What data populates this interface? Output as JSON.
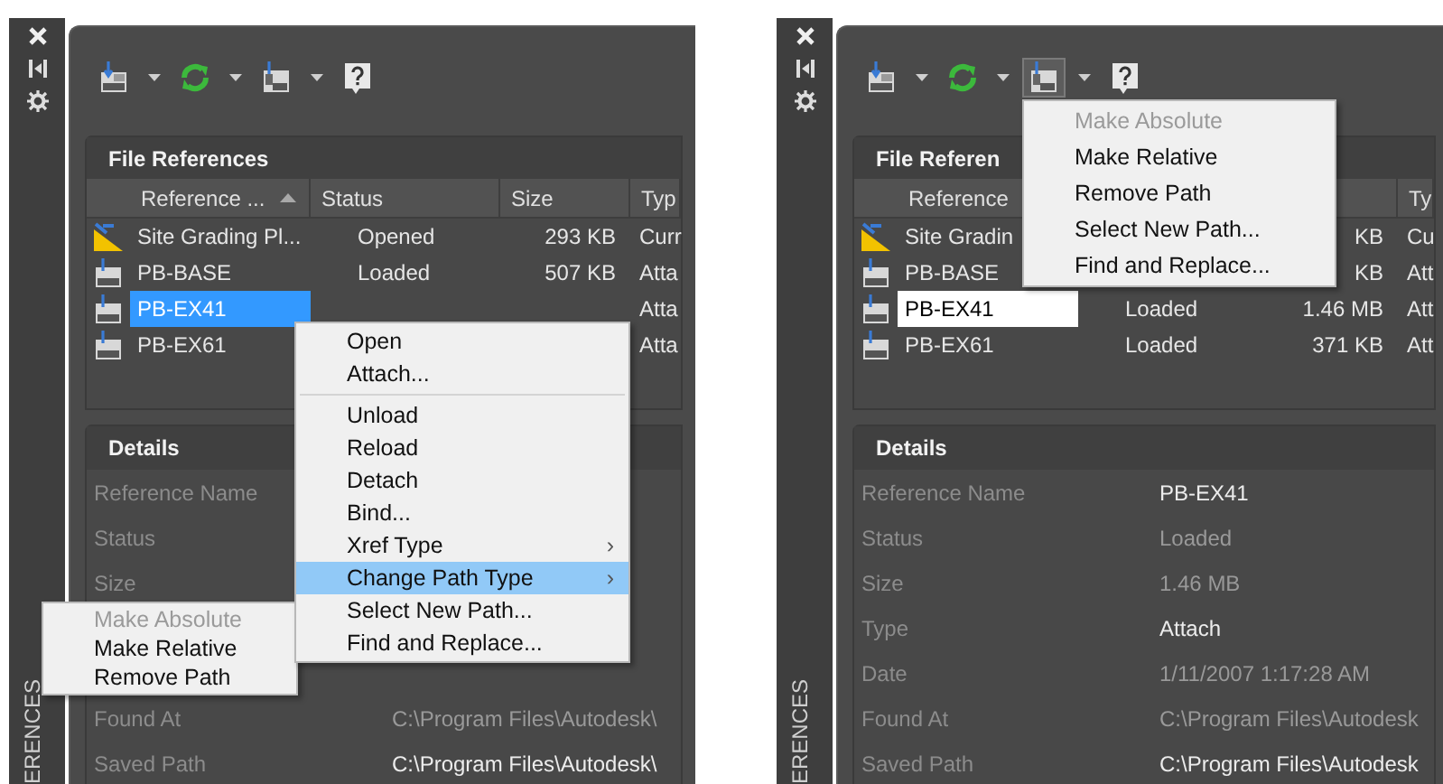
{
  "panels": [
    {
      "strip": {
        "title": "ERENCES"
      },
      "toolbar": [
        {
          "kind": "attach",
          "caret": true,
          "pressed": false
        },
        {
          "kind": "refresh",
          "caret": true,
          "pressed": false
        },
        {
          "kind": "path",
          "caret": true,
          "pressed": false
        },
        {
          "kind": "help",
          "caret": false,
          "pressed": false
        }
      ],
      "file_references": {
        "title": "File References",
        "list_focused": true,
        "columns": [
          {
            "label": "Reference ...",
            "sorted": true
          },
          {
            "label": "Status",
            "sorted": false
          },
          {
            "label": "Size",
            "sorted": false
          },
          {
            "label": "Typ",
            "sorted": false
          }
        ],
        "rows": [
          {
            "kind": "current",
            "name": "Site Grading Pl...",
            "status": "Opened",
            "size": "293 KB",
            "type": "Curr",
            "selected": false
          },
          {
            "kind": "dwg",
            "name": "PB-BASE",
            "status": "Loaded",
            "size": "507 KB",
            "type": "Atta",
            "selected": false
          },
          {
            "kind": "dwg",
            "name": "PB-EX41",
            "type": "Atta",
            "selected": true
          },
          {
            "kind": "dwg",
            "name": "PB-EX61",
            "type": "Atta",
            "selected": false
          }
        ]
      },
      "details": {
        "title": "Details",
        "fields": [
          {
            "label": "Reference Name"
          },
          {
            "label": "Status"
          },
          {
            "label": "Size"
          },
          {
            "kind": "covered"
          },
          {
            "kind": "covered"
          },
          {
            "label": "Found At",
            "value": "C:\\Program Files\\Autodesk\\",
            "editable": false
          },
          {
            "label": "Saved Path",
            "value": "C:\\Program Files\\Autodesk\\",
            "editable": true
          }
        ]
      },
      "menus": [
        {
          "kind": "submenu",
          "items": [
            {
              "kind": "item",
              "label": "Make Absolute",
              "disabled": true,
              "selected": false
            },
            {
              "kind": "item",
              "label": "Make Relative",
              "disabled": false,
              "selected": false
            },
            {
              "kind": "item",
              "label": "Remove Path",
              "disabled": false,
              "selected": false
            }
          ]
        },
        {
          "kind": "context",
          "items": [
            {
              "kind": "item",
              "label": "Open",
              "disabled": false,
              "selected": false
            },
            {
              "kind": "item",
              "label": "Attach...",
              "disabled": false,
              "selected": false
            },
            {
              "kind": "separator"
            },
            {
              "kind": "item",
              "label": "Unload",
              "disabled": false,
              "selected": false
            },
            {
              "kind": "item",
              "label": "Reload",
              "disabled": false,
              "selected": false
            },
            {
              "kind": "item",
              "label": "Detach",
              "disabled": false,
              "selected": false
            },
            {
              "kind": "item",
              "label": "Bind...",
              "disabled": false,
              "selected": false
            },
            {
              "kind": "item",
              "label": "Xref Type",
              "arrow": "›",
              "disabled": false,
              "selected": false
            },
            {
              "kind": "item",
              "label": "Change Path Type",
              "arrow": "›",
              "disabled": false,
              "selected": true
            },
            {
              "kind": "item",
              "label": "Select New Path...",
              "disabled": false,
              "selected": false
            },
            {
              "kind": "item",
              "label": "Find and Replace...",
              "disabled": false,
              "selected": false
            }
          ]
        }
      ]
    },
    {
      "strip": {
        "title": "ERENCES"
      },
      "toolbar": [
        {
          "kind": "attach",
          "caret": true,
          "pressed": false
        },
        {
          "kind": "refresh",
          "caret": true,
          "pressed": false
        },
        {
          "kind": "path",
          "caret": true,
          "pressed": true
        },
        {
          "kind": "help",
          "caret": false,
          "pressed": false
        }
      ],
      "file_references": {
        "title": "File Referen",
        "list_focused": false,
        "columns": [
          {
            "label": "Reference",
            "sorted": false
          },
          {},
          {},
          {
            "label": "Ty",
            "sorted": false
          }
        ],
        "rows": [
          {
            "kind": "current",
            "name": "Site Gradin",
            "size": "KB",
            "type": "Cu",
            "selected": false
          },
          {
            "kind": "dwg",
            "name": "PB-BASE",
            "size": "KB",
            "type": "Att",
            "selected": false
          },
          {
            "kind": "dwg",
            "name": "PB-EX41",
            "status": "Loaded",
            "size": "1.46 MB",
            "type": "Att",
            "selected": true
          },
          {
            "kind": "dwg",
            "name": "PB-EX61",
            "status": "Loaded",
            "size": "371 KB",
            "type": "Att",
            "selected": false
          }
        ]
      },
      "details": {
        "title": "Details",
        "fields": [
          {
            "label": "Reference Name",
            "value": "PB-EX41",
            "editable": true
          },
          {
            "label": "Status",
            "value": "Loaded",
            "editable": false
          },
          {
            "label": "Size",
            "value": "1.46 MB",
            "editable": false
          },
          {
            "label": "Type",
            "value": "Attach",
            "editable": true
          },
          {
            "label": "Date",
            "value": "1/11/2007 1:17:28 AM",
            "editable": false
          },
          {
            "label": "Found At",
            "value": "C:\\Program Files\\Autodesk",
            "editable": false
          },
          {
            "label": "Saved Path",
            "value": "C:\\Program Files\\Autodesk",
            "editable": true
          }
        ]
      },
      "menus": [
        {
          "kind": "dropdown",
          "items": [
            {
              "kind": "item",
              "label": "Make Absolute",
              "disabled": true,
              "selected": false
            },
            {
              "kind": "item",
              "label": "Make Relative",
              "disabled": false,
              "selected": false
            },
            {
              "kind": "item",
              "label": "Remove Path",
              "disabled": false,
              "selected": false
            },
            {
              "kind": "item",
              "label": "Select New Path...",
              "disabled": false,
              "selected": false
            },
            {
              "kind": "item",
              "label": "Find and Replace...",
              "disabled": false,
              "selected": false
            }
          ]
        }
      ]
    }
  ]
}
